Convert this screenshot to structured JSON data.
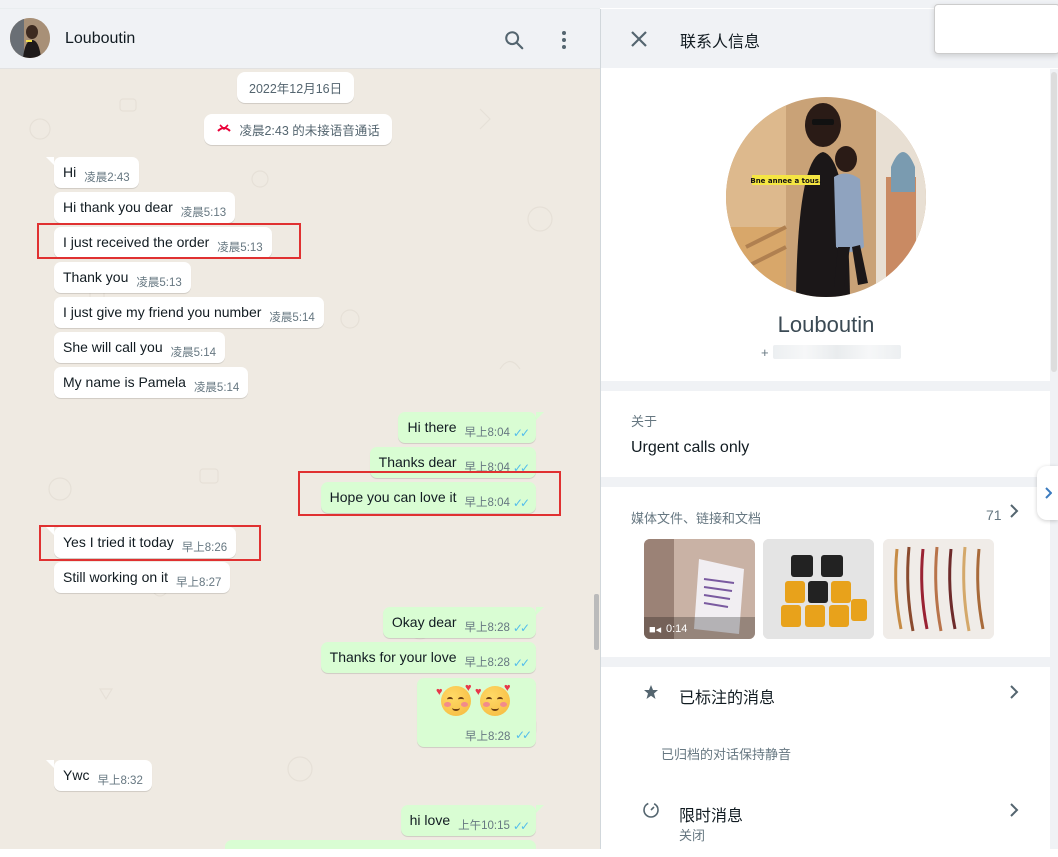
{
  "chat": {
    "contact_name": "Louboutin",
    "date_pill": "2022年12月16日",
    "missed_call": "凌晨2:43 的未接语音通话",
    "messages": [
      {
        "text": "Hi",
        "time": "凌晨2:43"
      },
      {
        "text": "Hi thank you dear",
        "time": "凌晨5:13"
      },
      {
        "text": "I just received the order",
        "time": "凌晨5:13"
      },
      {
        "text": "Thank you",
        "time": "凌晨5:13"
      },
      {
        "text": "I just give my friend you number",
        "time": "凌晨5:14"
      },
      {
        "text": "She will call you",
        "time": "凌晨5:14"
      },
      {
        "text": "My name is Pamela",
        "time": "凌晨5:14"
      },
      {
        "text": "Hi there",
        "time": "早上8:04"
      },
      {
        "text": "Thanks dear",
        "time": "早上8:04"
      },
      {
        "text": "Hope you can love it",
        "time": "早上8:04"
      },
      {
        "text": "Yes I tried it today",
        "time": "早上8:26"
      },
      {
        "text": "Still working on it",
        "time": "早上8:27"
      },
      {
        "text": "Okay dear",
        "time": "早上8:28"
      },
      {
        "text": "Thanks for your love",
        "time": "早上8:28"
      },
      {
        "text": "🥰🥰",
        "time": "早上8:28"
      },
      {
        "text": "Ywc",
        "time": "早上8:32"
      },
      {
        "text": "hi love",
        "time": "上午10:15"
      }
    ]
  },
  "info": {
    "title": "联系人信息",
    "name": "Louboutin",
    "phone_prefix": "+",
    "avatar_caption": "Bne annee a tous.",
    "about_label": "关于",
    "about_value": "Urgent calls only",
    "media_label": "媒体文件、链接和文档",
    "media_count": "71",
    "video_duration": "0:14",
    "starred_label": "已标注的消息",
    "archived_note": "已归档的对话保持静音",
    "disappearing_label": "限时消息",
    "disappearing_sub": "关闭"
  },
  "colors": {
    "chat_bg": "#efeae2",
    "outgoing_bubble": "#d9fdd3",
    "incoming_bubble": "#ffffff",
    "read_tick": "#53bdeb",
    "annotation_red": "#e03131",
    "panel_bg": "#f0f2f5"
  },
  "icons": [
    "search-icon",
    "menu-dots-icon",
    "close-icon",
    "chevron-right-icon",
    "star-icon",
    "timer-icon",
    "missed-call-icon",
    "video-icon",
    "double-tick-icon"
  ]
}
